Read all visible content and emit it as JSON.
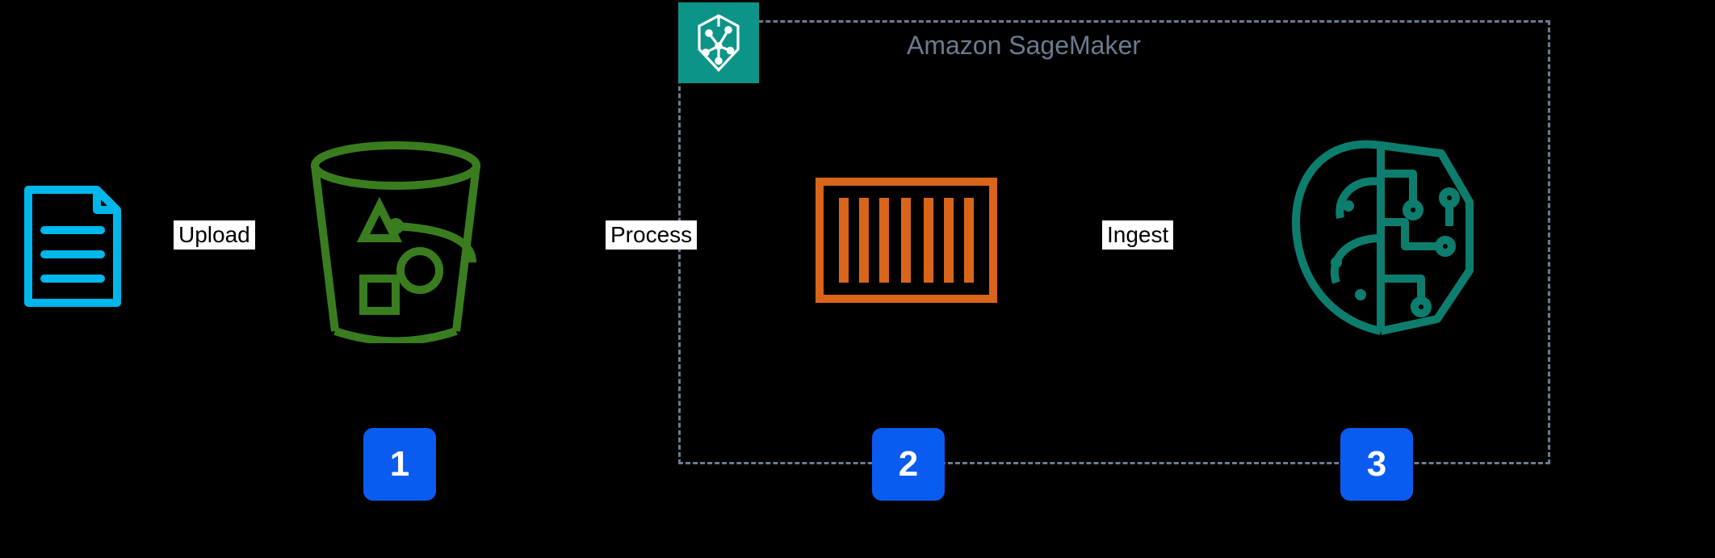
{
  "container": {
    "title": "Amazon SageMaker"
  },
  "arrows": {
    "upload": "Upload",
    "process": "Process",
    "ingest": "Ingest"
  },
  "steps": {
    "one": "1",
    "two": "2",
    "three": "3"
  },
  "nodes": {
    "document": "document-icon",
    "bucket": "s3-bucket-icon",
    "container": "container-icon",
    "ml": "sagemaker-ml-icon"
  }
}
